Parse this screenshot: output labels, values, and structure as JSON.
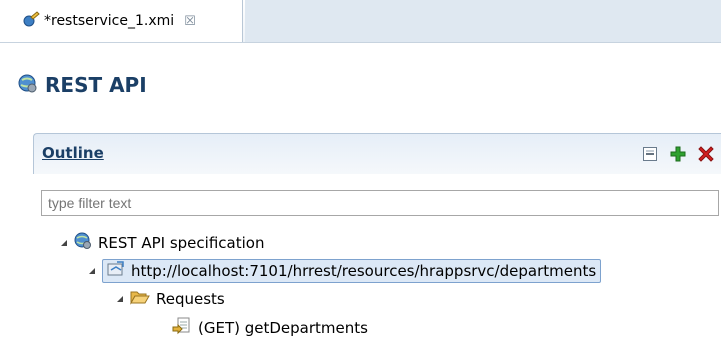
{
  "tab": {
    "title": "*restservice_1.xmi",
    "close_glyph": "☒"
  },
  "editor": {
    "title": "REST API"
  },
  "outline": {
    "title": "Outline",
    "filter_placeholder": "type filter text",
    "tree": [
      {
        "label": "REST API specification",
        "icon": "globe-icon",
        "expanded": true
      },
      {
        "label": "http://localhost:7101/hrrest/resources/hrappsrvc/departments",
        "icon": "resource-link-icon",
        "expanded": true,
        "selected": true
      },
      {
        "label": "Requests",
        "icon": "folder-open-icon",
        "expanded": true
      },
      {
        "label": "(GET) getDepartments",
        "icon": "request-icon",
        "expanded": false
      }
    ]
  },
  "colors": {
    "accent": "#1b3f66",
    "add": "#2fa12f",
    "delete": "#d42020"
  }
}
